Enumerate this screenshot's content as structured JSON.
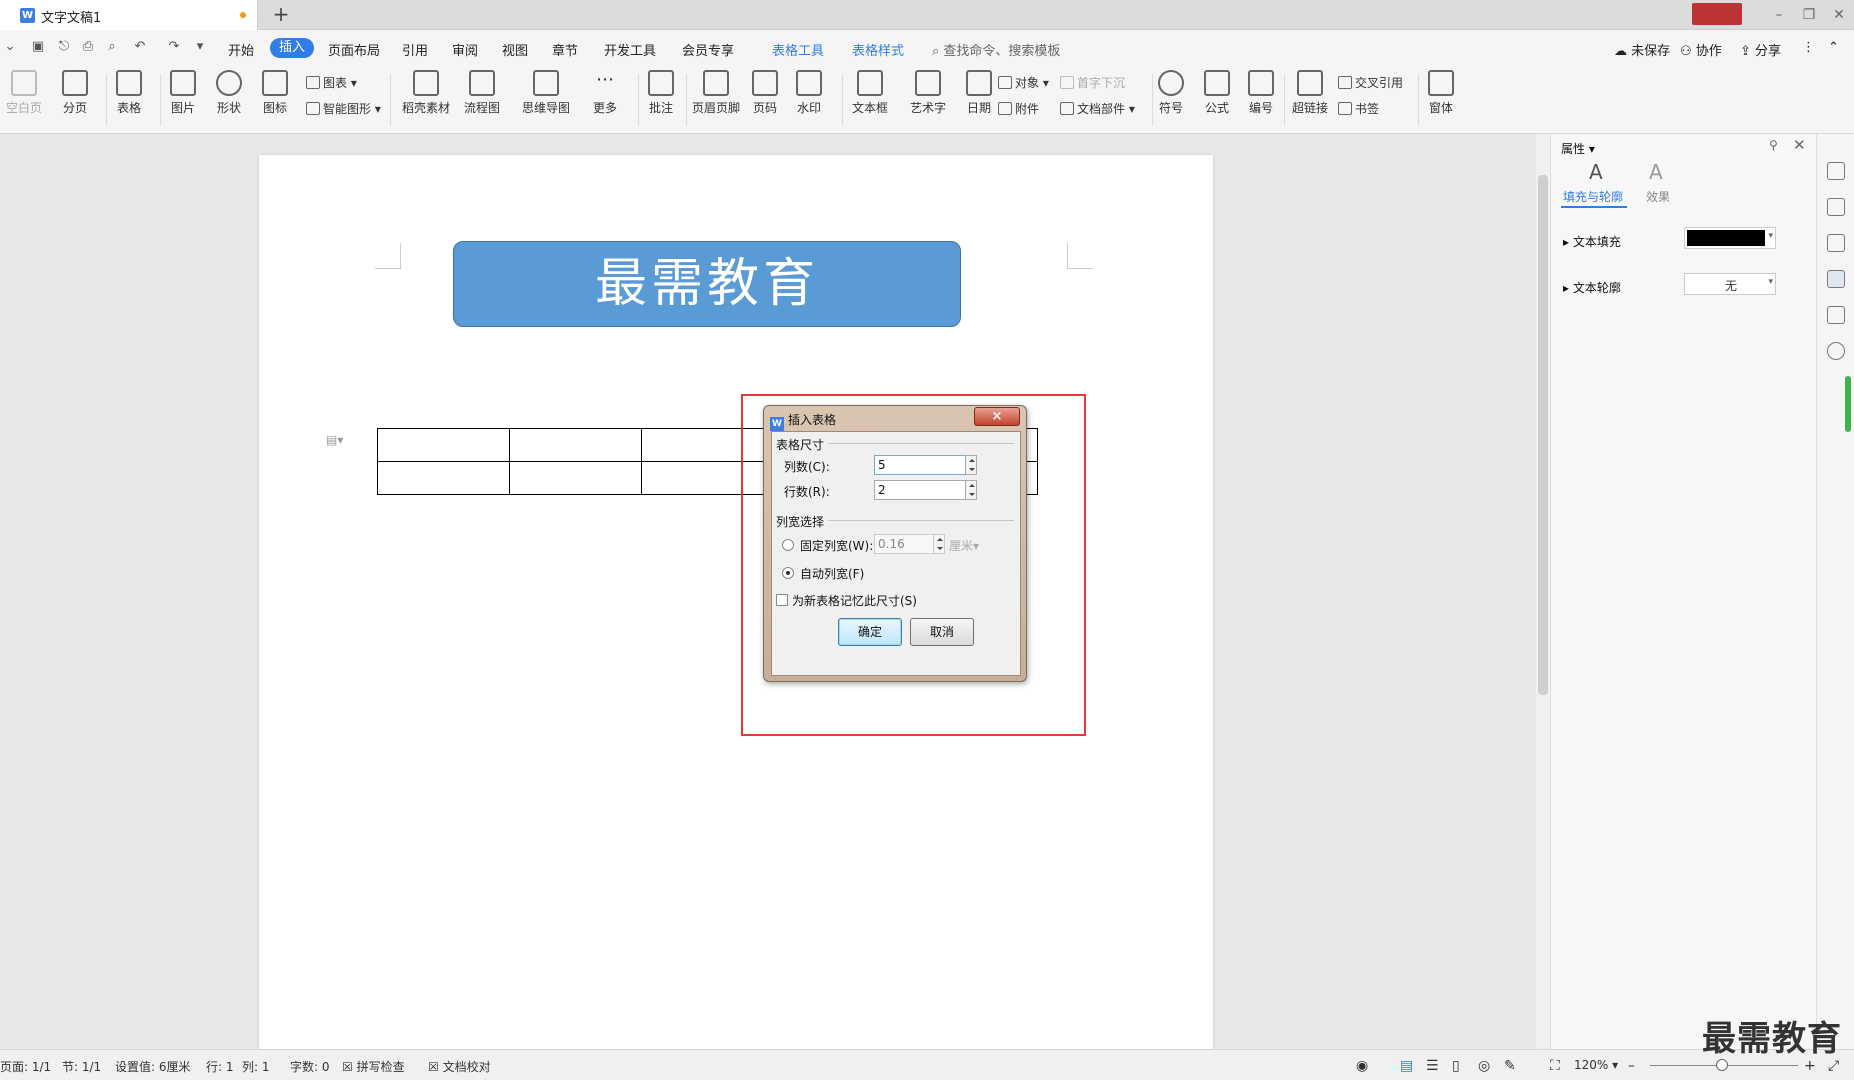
{
  "titlebar": {
    "doc_tab": "文字文稿1",
    "new_tab": "+"
  },
  "menu": {
    "items": [
      "开始",
      "插入",
      "页面布局",
      "引用",
      "审阅",
      "视图",
      "章节",
      "开发工具",
      "会员专享"
    ],
    "active": "插入",
    "tool_tabs": [
      "表格工具",
      "表格样式"
    ],
    "search": "查找命令、搜索模板",
    "right": {
      "unsaved": "未保存",
      "collab": "协作",
      "share": "分享"
    }
  },
  "ribbon": {
    "blank_page": "空白页",
    "page_break": "分页",
    "table": "表格",
    "picture": "图片",
    "shape": "形状",
    "icon": "图标",
    "chart": "图表",
    "smart_shape": "智能图形",
    "shell_material": "稻壳素材",
    "flowchart": "流程图",
    "mindmap": "思维导图",
    "more": "更多",
    "comment": "批注",
    "header_footer": "页眉页脚",
    "page_number": "页码",
    "watermark": "水印",
    "textbox": "文本框",
    "wordart": "艺术字",
    "date": "日期",
    "object": "对象",
    "attachment": "附件",
    "dropcap": "首字下沉",
    "doc_parts": "文档部件",
    "symbol": "符号",
    "formula": "公式",
    "numbering": "编号",
    "hyperlink": "超链接",
    "crossref": "交叉引用",
    "bookmark": "书签",
    "window": "窗体"
  },
  "document": {
    "banner_text": "最需教育"
  },
  "dialog": {
    "title": "插入表格",
    "close": "×",
    "group_size": "表格尺寸",
    "cols_label": "列数(C):",
    "cols_value": "5",
    "rows_label": "行数(R):",
    "rows_value": "2",
    "group_width": "列宽选择",
    "fixed_label": "固定列宽(W):",
    "fixed_value": "0.16",
    "fixed_unit": "厘米",
    "auto_label": "自动列宽(F)",
    "remember_label": "为新表格记忆此尺寸(S)",
    "ok": "确定",
    "cancel": "取消"
  },
  "panel": {
    "title": "属性",
    "tab_fill": "填充与轮廓",
    "tab_effect": "效果",
    "text_fill": "文本填充",
    "text_fill_color": "#000000",
    "text_outline": "文本轮廓",
    "text_outline_value": "无"
  },
  "statusbar": {
    "page": "页面: 1/1",
    "section": "节: 1/1",
    "setting": "设置值: 6厘米",
    "row": "行: 1",
    "col": "列: 1",
    "words": "字数: 0",
    "spell": "拼写检查",
    "proof": "文档校对",
    "zoom": "120%"
  },
  "watermark": "最需教育",
  "colors": {
    "accent": "#2f7de6",
    "banner": "#5b9bd5",
    "highlight_box": "#e53935"
  }
}
